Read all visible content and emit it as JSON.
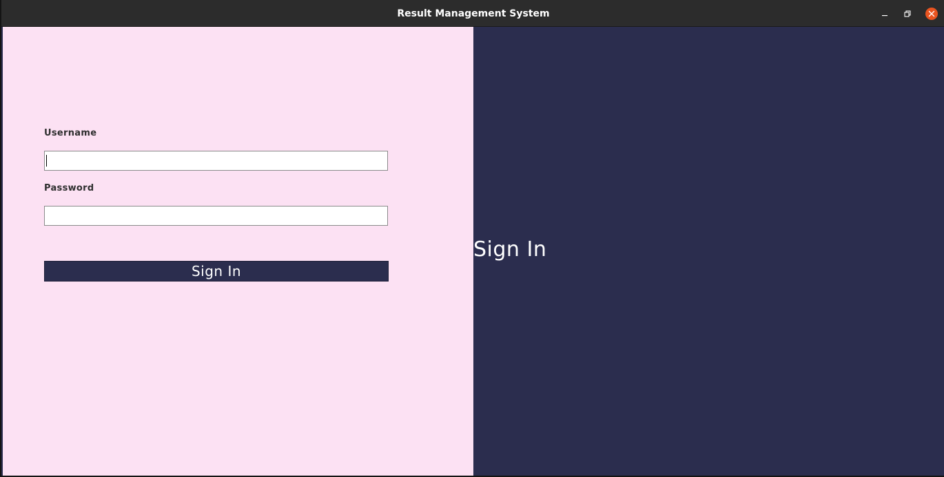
{
  "window": {
    "title": "Result Management System",
    "colors": {
      "titlebar": "#2c2c2c",
      "close_button": "#e95420",
      "left_pane": "#fce1f3",
      "right_pane": "#2b2d4e",
      "button": "#2b2d4e"
    },
    "controls": {
      "minimize_icon": "minimize-icon",
      "maximize_icon": "restore-icon",
      "close_icon": "close-icon"
    }
  },
  "form": {
    "username_label": "Username",
    "username_value": "",
    "password_label": "Password",
    "password_value": "",
    "submit_label": "Sign In"
  },
  "banner": {
    "heading": "Sign In"
  }
}
